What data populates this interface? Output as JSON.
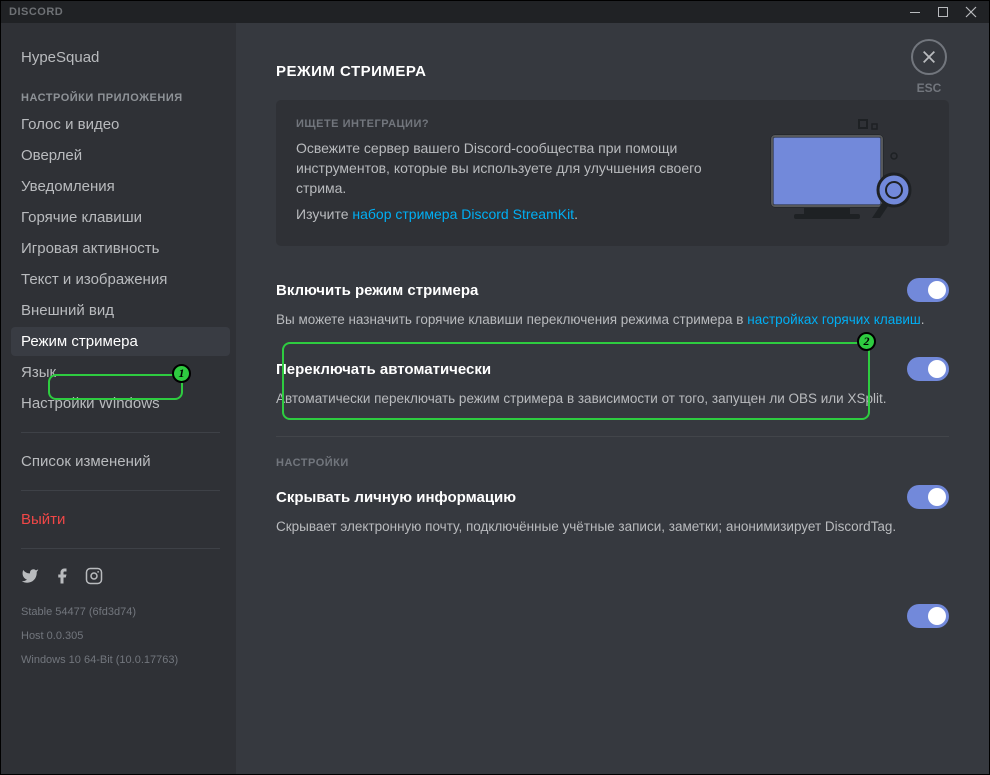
{
  "titlebar": {
    "title": "DISCORD"
  },
  "esc": {
    "label": "ESC"
  },
  "sidebar": {
    "items_top": [
      {
        "label": "HypeSquad"
      }
    ],
    "header_app": "НАСТРОЙКИ ПРИЛОЖЕНИЯ",
    "items_app": [
      {
        "label": "Голос и видео"
      },
      {
        "label": "Оверлей"
      },
      {
        "label": "Уведомления"
      },
      {
        "label": "Горячие клавиши"
      },
      {
        "label": "Игровая активность"
      },
      {
        "label": "Текст и изображения"
      },
      {
        "label": "Внешний вид"
      },
      {
        "label": "Режим стримера",
        "active": true
      },
      {
        "label": "Язык"
      },
      {
        "label": "Настройки Windows"
      }
    ],
    "changelog": "Список изменений",
    "logout": "Выйти",
    "build_info": {
      "line1": "Stable 54477 (6fd3d74)",
      "line2": "Host 0.0.305",
      "line3": "Windows 10 64-Bit (10.0.17763)"
    }
  },
  "page": {
    "title": "РЕЖИМ СТРИМЕРА",
    "promo": {
      "heading": "ИЩЕТЕ ИНТЕГРАЦИИ?",
      "body": "Освежите сервер вашего Discord-сообщества при помощи инструментов, которые вы используете для улучшения своего стрима.",
      "link_prefix": "Изучите ",
      "link_text": "набор стримера Discord StreamKit",
      "link_suffix": "."
    },
    "settings": [
      {
        "title": "Включить режим стримера",
        "desc_prefix": "Вы можете назначить горячие клавиши переключения режима стримера в ",
        "desc_link": "настройках горячих клавиш",
        "desc_suffix": ".",
        "on": true
      },
      {
        "title": "Переключать автоматически",
        "desc": "Автоматически переключать режим стримера в зависимости от того, запущен ли OBS или XSplit.",
        "on": true
      }
    ],
    "section_header": "НАСТРОЙКИ",
    "settings2": [
      {
        "title": "Скрывать личную информацию",
        "desc": "Скрывает электронную почту, подключённые учётные записи, заметки; анонимизирует DiscordTag.",
        "on": true
      }
    ]
  },
  "annotations": {
    "b1": "1",
    "b2": "2"
  }
}
